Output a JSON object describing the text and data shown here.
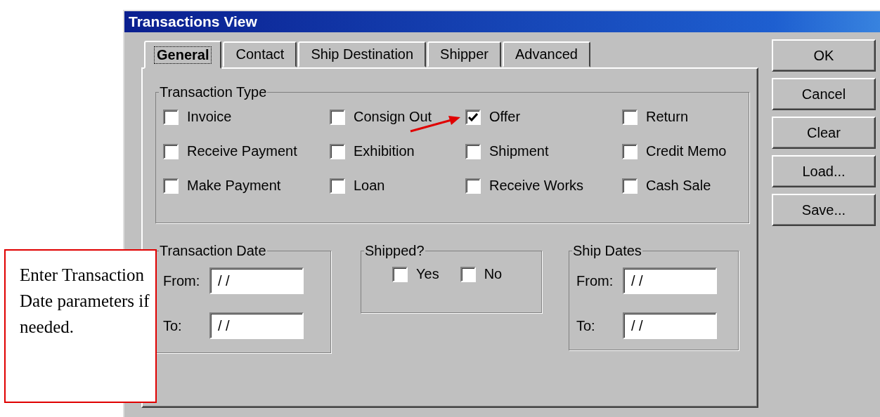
{
  "window": {
    "title": "Transactions View"
  },
  "tabs": [
    {
      "label": "General",
      "selected": true
    },
    {
      "label": "Contact",
      "selected": false
    },
    {
      "label": "Ship Destination",
      "selected": false
    },
    {
      "label": "Shipper",
      "selected": false
    },
    {
      "label": "Advanced",
      "selected": false
    }
  ],
  "transaction_type": {
    "label": "Transaction Type",
    "options": [
      {
        "label": "Invoice",
        "checked": false
      },
      {
        "label": "Consign Out",
        "checked": false
      },
      {
        "label": "Offer",
        "checked": true
      },
      {
        "label": "Return",
        "checked": false
      },
      {
        "label": "Receive Payment",
        "checked": false
      },
      {
        "label": "Exhibition",
        "checked": false
      },
      {
        "label": "Shipment",
        "checked": false
      },
      {
        "label": "Credit Memo",
        "checked": false
      },
      {
        "label": "Make Payment",
        "checked": false
      },
      {
        "label": "Loan",
        "checked": false
      },
      {
        "label": "Receive Works",
        "checked": false
      },
      {
        "label": "Cash Sale",
        "checked": false
      }
    ]
  },
  "transaction_date": {
    "label": "Transaction Date",
    "fields": [
      {
        "label": "From:",
        "value": "/ /"
      },
      {
        "label": "To:",
        "value": "/ /"
      }
    ]
  },
  "shipped": {
    "label": "Shipped?",
    "options": [
      {
        "label": "Yes",
        "checked": false
      },
      {
        "label": "No",
        "checked": false
      }
    ]
  },
  "ship_dates": {
    "label": "Ship Dates",
    "fields": [
      {
        "label": "From:",
        "value": "/ /"
      },
      {
        "label": "To:",
        "value": "/ /"
      }
    ]
  },
  "buttons": [
    {
      "label": "OK"
    },
    {
      "label": "Cancel"
    },
    {
      "label": "Clear"
    },
    {
      "label": "Load..."
    },
    {
      "label": "Save..."
    }
  ],
  "annotation": {
    "text": "Enter Transaction Date parameters if needed."
  }
}
